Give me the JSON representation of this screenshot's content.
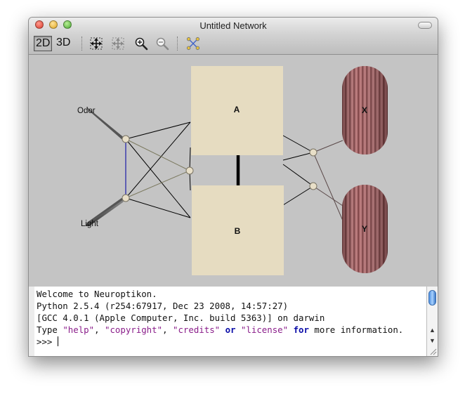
{
  "window": {
    "title": "Untitled Network"
  },
  "toolbar": {
    "view_2d": "2D",
    "view_3d": "3D",
    "icons": [
      "fit-to-window-icon",
      "fit-selection-icon",
      "zoom-in-icon",
      "zoom-out-icon",
      "network-layout-icon"
    ]
  },
  "network": {
    "regions": [
      {
        "id": "A",
        "label": "A",
        "shape": "box",
        "color": "#e6dcc1"
      },
      {
        "id": "B",
        "label": "B",
        "shape": "box",
        "color": "#e6dcc1"
      },
      {
        "id": "X",
        "label": "X",
        "shape": "capsule",
        "color": "#b0686a"
      },
      {
        "id": "Y",
        "label": "Y",
        "shape": "capsule",
        "color": "#b0686a"
      }
    ],
    "inputs": [
      {
        "label": "Odor"
      },
      {
        "label": "Light"
      }
    ]
  },
  "console": {
    "line1": "Welcome to Neuroptikon.",
    "line2": "Python 2.5.4 (r254:67917, Dec 23 2008, 14:57:27)",
    "line3": "[GCC 4.0.1 (Apple Computer, Inc. build 5363)] on darwin",
    "line4": {
      "type": "Type ",
      "help": "\"help\"",
      "sep1": ", ",
      "copyright": "\"copyright\"",
      "sep2": ", ",
      "credits": "\"credits\"",
      "or": " or ",
      "license": "\"license\"",
      "for": " for ",
      "rest": "more information."
    },
    "prompt": ">>> "
  }
}
